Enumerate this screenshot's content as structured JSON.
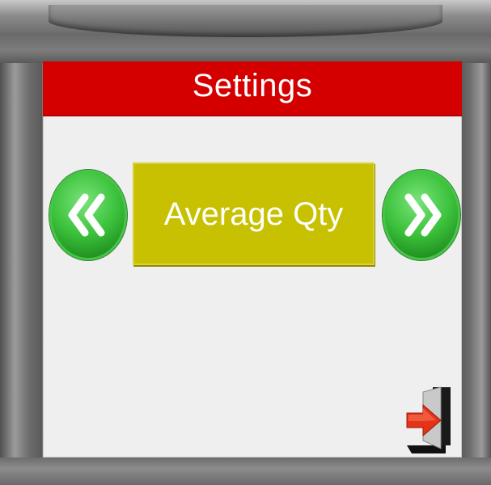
{
  "screen": {
    "title": "Settings",
    "option_label": "Average Qty"
  },
  "icons": {
    "prev": "chevron-double-left-icon",
    "next": "chevron-double-right-icon",
    "exit": "exit-door-icon"
  },
  "colors": {
    "title_bar": "#d40000",
    "option_panel": "#c7c102",
    "nav_button": "#3cc23c"
  }
}
